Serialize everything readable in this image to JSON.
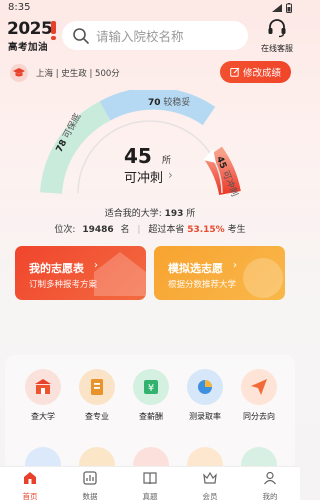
{
  "status": {
    "time": "8:35"
  },
  "header": {
    "logo_year": "2025",
    "logo_sub": "高考加油",
    "search_placeholder": "请输入院校名称",
    "service_label": "在线客服"
  },
  "profile": {
    "text": "上海 | 史生政 | 500分",
    "edit_button": "修改成绩"
  },
  "gauge": {
    "total": "45",
    "unit": "所",
    "caption": "可冲刺",
    "safe": {
      "count": "78",
      "label": "可保底"
    },
    "steady": {
      "count": "70",
      "label": "较稳妥"
    },
    "rush": {
      "count": "45",
      "label": "可冲刺"
    },
    "colors": {
      "safe": "#c9ebdc",
      "steady": "#b5d9f3",
      "rush": "#f05b40"
    }
  },
  "stats": {
    "suitable_label": "适合我的大学:",
    "suitable_count": "193",
    "suitable_unit": "所",
    "rank_label": "位次:",
    "rank_value": "19486",
    "rank_unit": "名",
    "beyond_label": "超过本省",
    "beyond_value": "53.15%",
    "beyond_unit": "考生"
  },
  "cards": [
    {
      "title": "我的志愿表",
      "subtitle": "订制多种报考方案"
    },
    {
      "title": "模拟选志愿",
      "subtitle": "根据分数推荐大学"
    }
  ],
  "tools": [
    {
      "label": "查大学"
    },
    {
      "label": "查专业"
    },
    {
      "label": "查薪酬"
    },
    {
      "label": "测录取率"
    },
    {
      "label": "同分去向"
    }
  ],
  "tabs": [
    {
      "label": "首页"
    },
    {
      "label": "数据"
    },
    {
      "label": "真题"
    },
    {
      "label": "会员"
    },
    {
      "label": "我的"
    }
  ]
}
